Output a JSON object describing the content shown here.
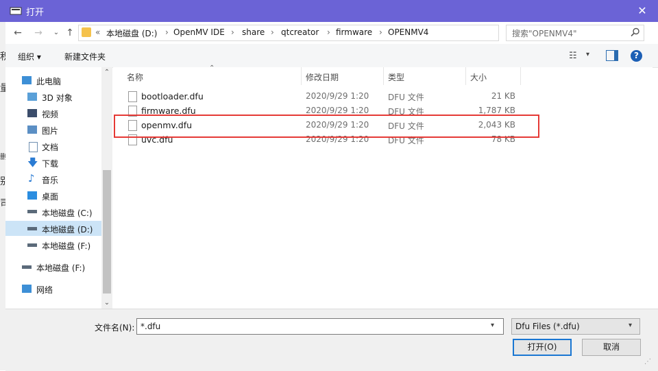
{
  "window": {
    "title": "打开",
    "close_glyph": "✕"
  },
  "left_strip_chars": [
    "积",
    "量",
    "删",
    "别",
    "司"
  ],
  "nav": {
    "back": "←",
    "forward": "→",
    "dropdown": "⌄",
    "up": "↑"
  },
  "address": {
    "prefix": "«",
    "crumbs": [
      "本地磁盘 (D:)",
      "OpenMV IDE",
      "share",
      "qtcreator",
      "firmware",
      "OPENMV4"
    ],
    "separator": "›",
    "dropdown_glyph": "⌄",
    "refresh_glyph": "↻"
  },
  "search": {
    "placeholder": "搜索\"OPENMV4\"",
    "icon": "search-icon"
  },
  "toolbar": {
    "organize": "组织 ▾",
    "new_folder": "新建文件夹",
    "view_glyph": "☷",
    "view_dd": "▾",
    "help": "?"
  },
  "sidebar": {
    "items": [
      {
        "label": "此电脑",
        "icon": "computer-icon",
        "color": "#3d8fd6"
      },
      {
        "label": "3D 对象",
        "icon": "cube-icon",
        "color": "#5aa0d8"
      },
      {
        "label": "视频",
        "icon": "video-icon",
        "color": "#3b4d6b"
      },
      {
        "label": "图片",
        "icon": "picture-icon",
        "color": "#5b8fc4"
      },
      {
        "label": "文档",
        "icon": "document-icon",
        "color": "#6f8fb0"
      },
      {
        "label": "下载",
        "icon": "download-icon",
        "color": "#2a7bd3"
      },
      {
        "label": "音乐",
        "icon": "music-icon",
        "color": "#2a7bd3"
      },
      {
        "label": "桌面",
        "icon": "desktop-icon",
        "color": "#2a8de0"
      },
      {
        "label": "本地磁盘 (C:)",
        "icon": "drive-c-icon",
        "color": "#5b6a7a"
      },
      {
        "label": "本地磁盘 (D:)",
        "icon": "drive-d-icon",
        "color": "#5b6a7a"
      },
      {
        "label": "本地磁盘 (F:)",
        "icon": "drive-f-icon",
        "color": "#5b6a7a"
      },
      {
        "label": "本地磁盘 (F:)",
        "icon": "drive-f-icon",
        "color": "#5b6a7a"
      },
      {
        "label": "网络",
        "icon": "network-icon",
        "color": "#3d8fd6"
      }
    ],
    "scroll_up": "⌃",
    "scroll_down": "⌄"
  },
  "columns": {
    "name": "名称",
    "modified": "修改日期",
    "type": "类型",
    "size": "大小",
    "sort_glyph": "⌃"
  },
  "files": [
    {
      "name": "bootloader.dfu",
      "modified": "2020/9/29 1:20",
      "type": "DFU 文件",
      "size": "21 KB"
    },
    {
      "name": "firmware.dfu",
      "modified": "2020/9/29 1:20",
      "type": "DFU 文件",
      "size": "1,787 KB"
    },
    {
      "name": "openmv.dfu",
      "modified": "2020/9/29 1:20",
      "type": "DFU 文件",
      "size": "2,043 KB"
    },
    {
      "name": "uvc.dfu",
      "modified": "2020/9/29 1:20",
      "type": "DFU 文件",
      "size": "78 KB"
    }
  ],
  "filename": {
    "label": "文件名(N):",
    "value": "*.dfu",
    "dd": "▾"
  },
  "filter": {
    "value": "Dfu Files (*.dfu)",
    "dd": "▾"
  },
  "buttons": {
    "open": "打开(O)",
    "cancel": "取消"
  },
  "grip": "⋰",
  "accent": "#6b63d6",
  "highlight_color": "#e53935"
}
